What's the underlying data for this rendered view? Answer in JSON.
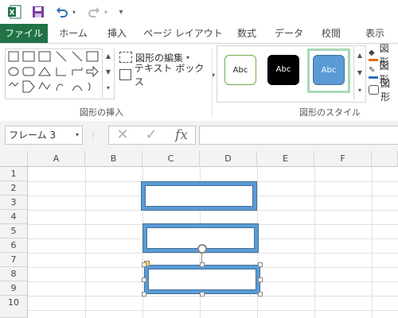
{
  "qat": {
    "excel_icon": "excel-logo-icon",
    "save_icon": "save-icon",
    "undo_icon": "undo-icon",
    "redo_icon": "redo-icon",
    "customize_icon": "customize-qat-icon"
  },
  "tabs": [
    {
      "label": "ファイル"
    },
    {
      "label": "ホーム"
    },
    {
      "label": "挿入"
    },
    {
      "label": "ページ レイアウト"
    },
    {
      "label": "数式"
    },
    {
      "label": "データ"
    },
    {
      "label": "校閲"
    },
    {
      "label": "表示"
    }
  ],
  "ribbon": {
    "insert_shapes_group": {
      "label": "図形の挿入",
      "edit_shape_label": "図形の編集",
      "textbox_label": "テキスト ボックス"
    },
    "shape_styles_group": {
      "label": "図形のスタイル",
      "style_text": "Abc",
      "fill_label": "図形",
      "outline_label": "図形",
      "effect_label": "図形"
    }
  },
  "formula_bar": {
    "name_box_value": "フレーム 3",
    "fx_label": "fx",
    "formula_value": ""
  },
  "grid": {
    "columns": [
      "A",
      "B",
      "C",
      "D",
      "E",
      "F"
    ],
    "rows": [
      "1",
      "2",
      "3",
      "4",
      "5",
      "6",
      "7",
      "8",
      "9",
      "10"
    ]
  },
  "colors": {
    "file_tab": "#217346",
    "shape_border": "#5b9bd5",
    "selected_style_border": "#a9d8b8"
  }
}
